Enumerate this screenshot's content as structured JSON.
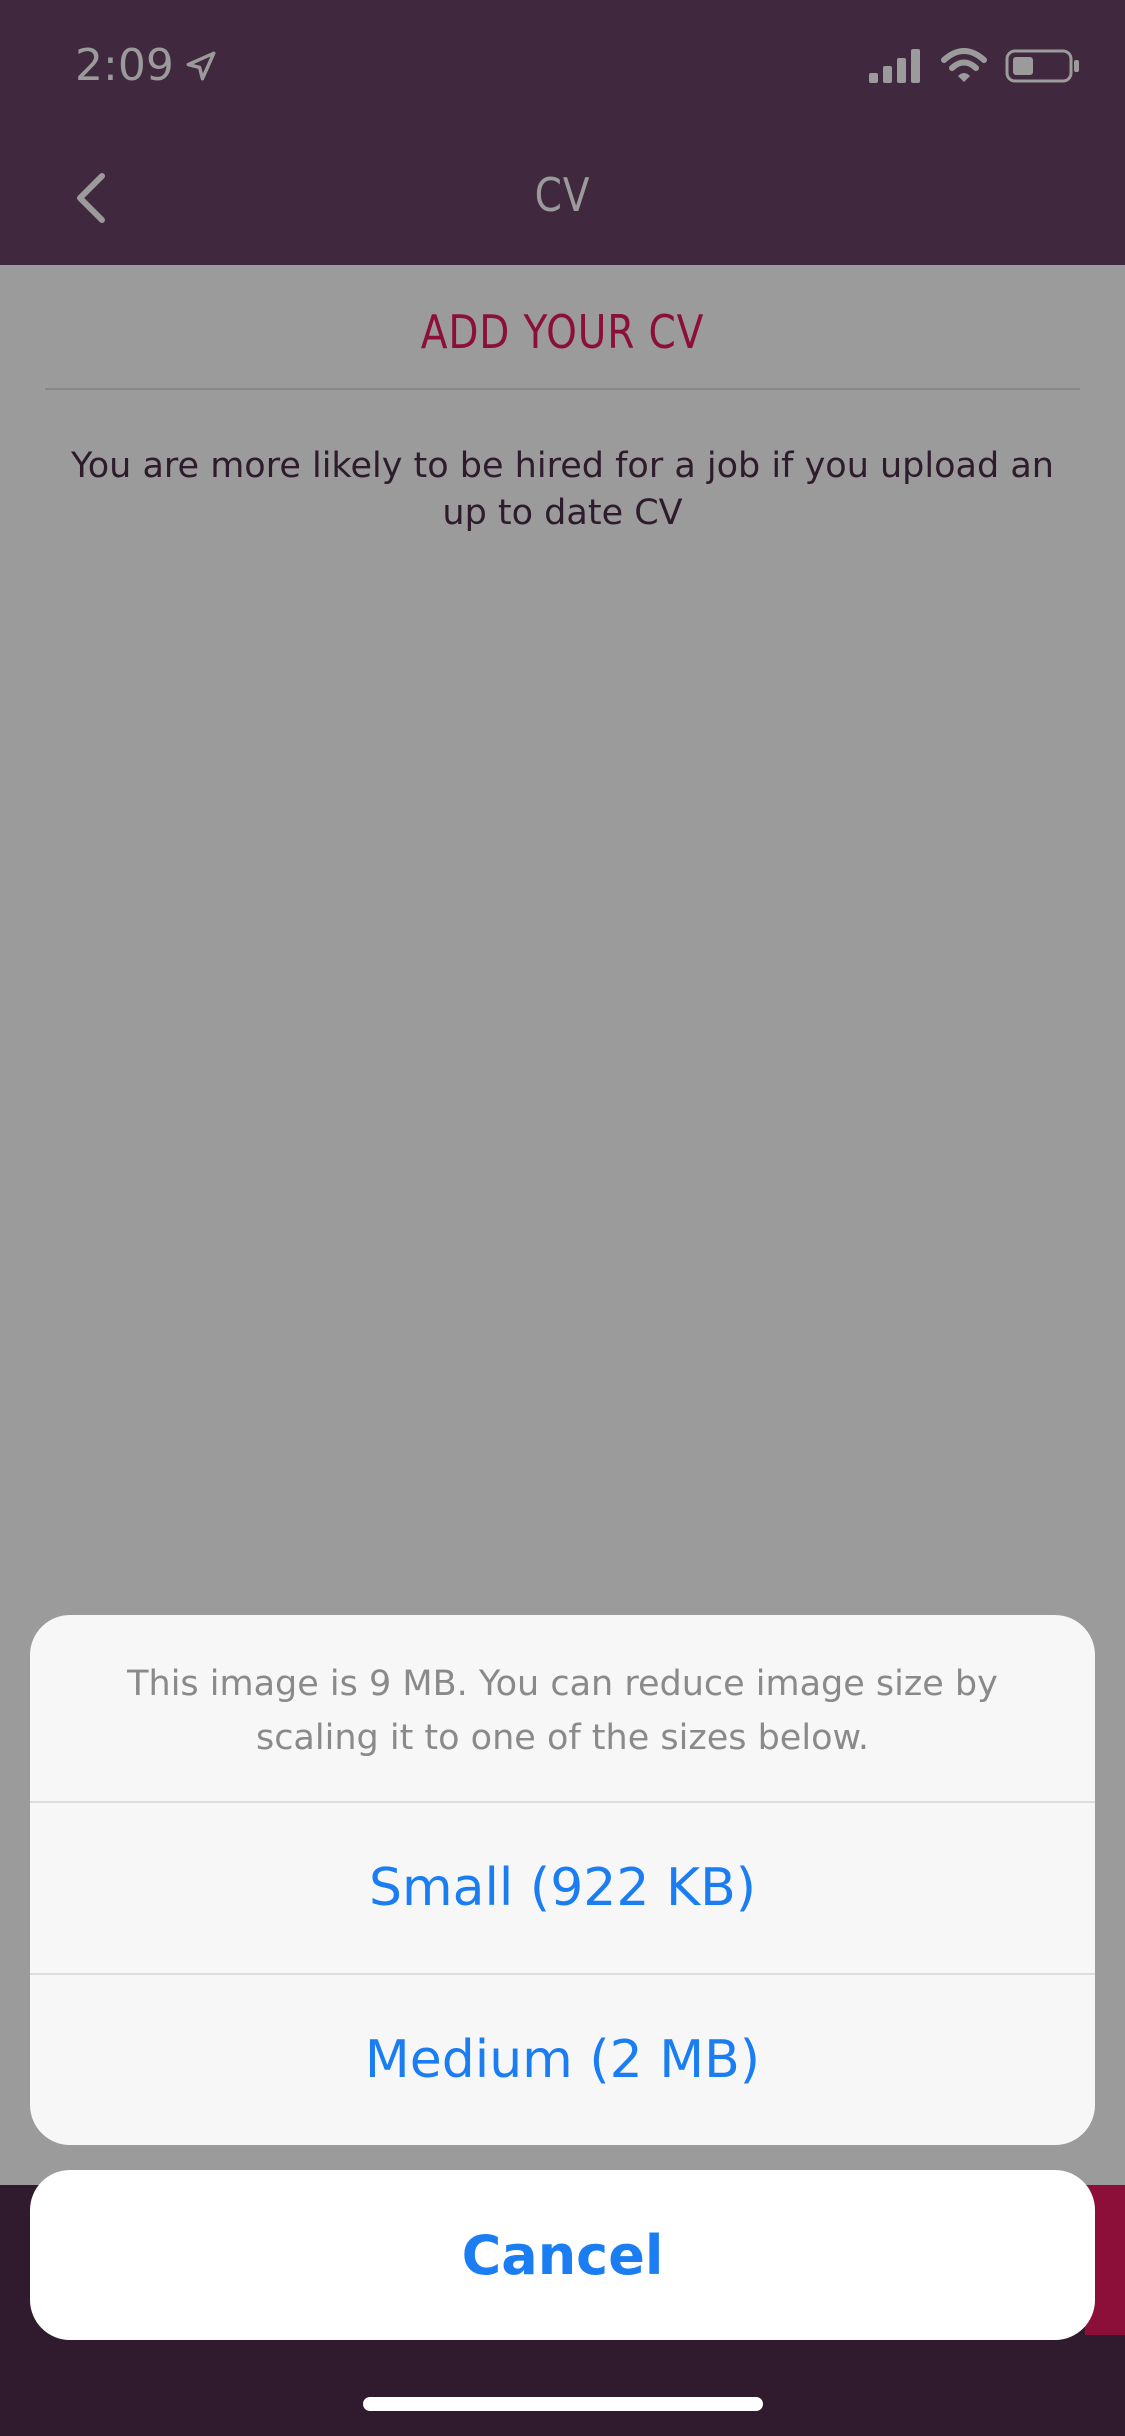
{
  "status_bar": {
    "time": "2:09",
    "icons": [
      "location-arrow-icon",
      "signal-icon",
      "wifi-icon",
      "battery-icon"
    ]
  },
  "nav": {
    "title": "CV",
    "back_icon": "chevron-left-icon"
  },
  "content": {
    "heading": "ADD YOUR CV",
    "intro": "You are more likely to be hired for a job if you upload an up to date CV"
  },
  "action_sheet": {
    "message": "This image is 9 MB. You can reduce image size by scaling it to one of the sizes below.",
    "options": [
      {
        "label": "Small (922 KB)"
      },
      {
        "label": "Medium (2 MB)"
      }
    ],
    "cancel_label": "Cancel"
  },
  "colors": {
    "header_bg": "#40293e",
    "accent": "#8c0f3a",
    "action_blue": "#1a7ef2",
    "dim_overlay": "#9b9b9b"
  }
}
